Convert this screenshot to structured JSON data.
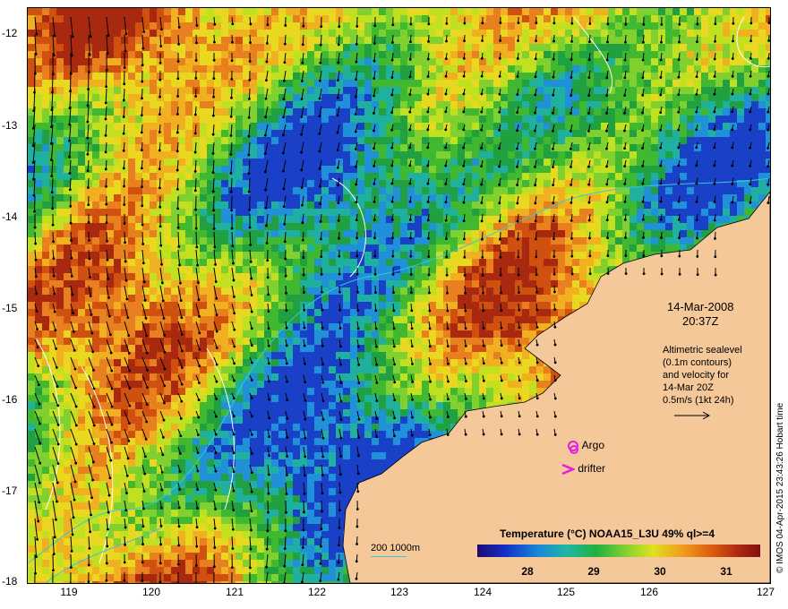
{
  "map": {
    "lat_labels": [
      "-12",
      "-13",
      "-14",
      "-15",
      "-16",
      "-17",
      "-18"
    ],
    "lon_labels": [
      "119",
      "120",
      "121",
      "122",
      "123",
      "124",
      "125",
      "126",
      "127"
    ],
    "land_color": "#f5c89a",
    "contour_color": "#ffffff",
    "bathy_color": "#36c8d8",
    "argo_color": "#e020e0"
  },
  "info": {
    "date": "14-Mar-2008",
    "time": "20:37Z",
    "lines": [
      "Altimetric sealevel",
      "(0.1m contours)",
      "and velocity for",
      "14-Mar 20Z",
      "0.5m/s (1kt 24h)"
    ]
  },
  "legend": {
    "argo": "Argo",
    "drifter": "drifter"
  },
  "colorbar": {
    "title": "Temperature (°C) NOAA15_L3U 49% ql>=4",
    "ticks": [
      "28",
      "29",
      "30",
      "31"
    ]
  },
  "depth": {
    "label": "200  1000m"
  },
  "credit": "© IMOS 04-Apr-2015 23:43:26 Hobart time"
}
